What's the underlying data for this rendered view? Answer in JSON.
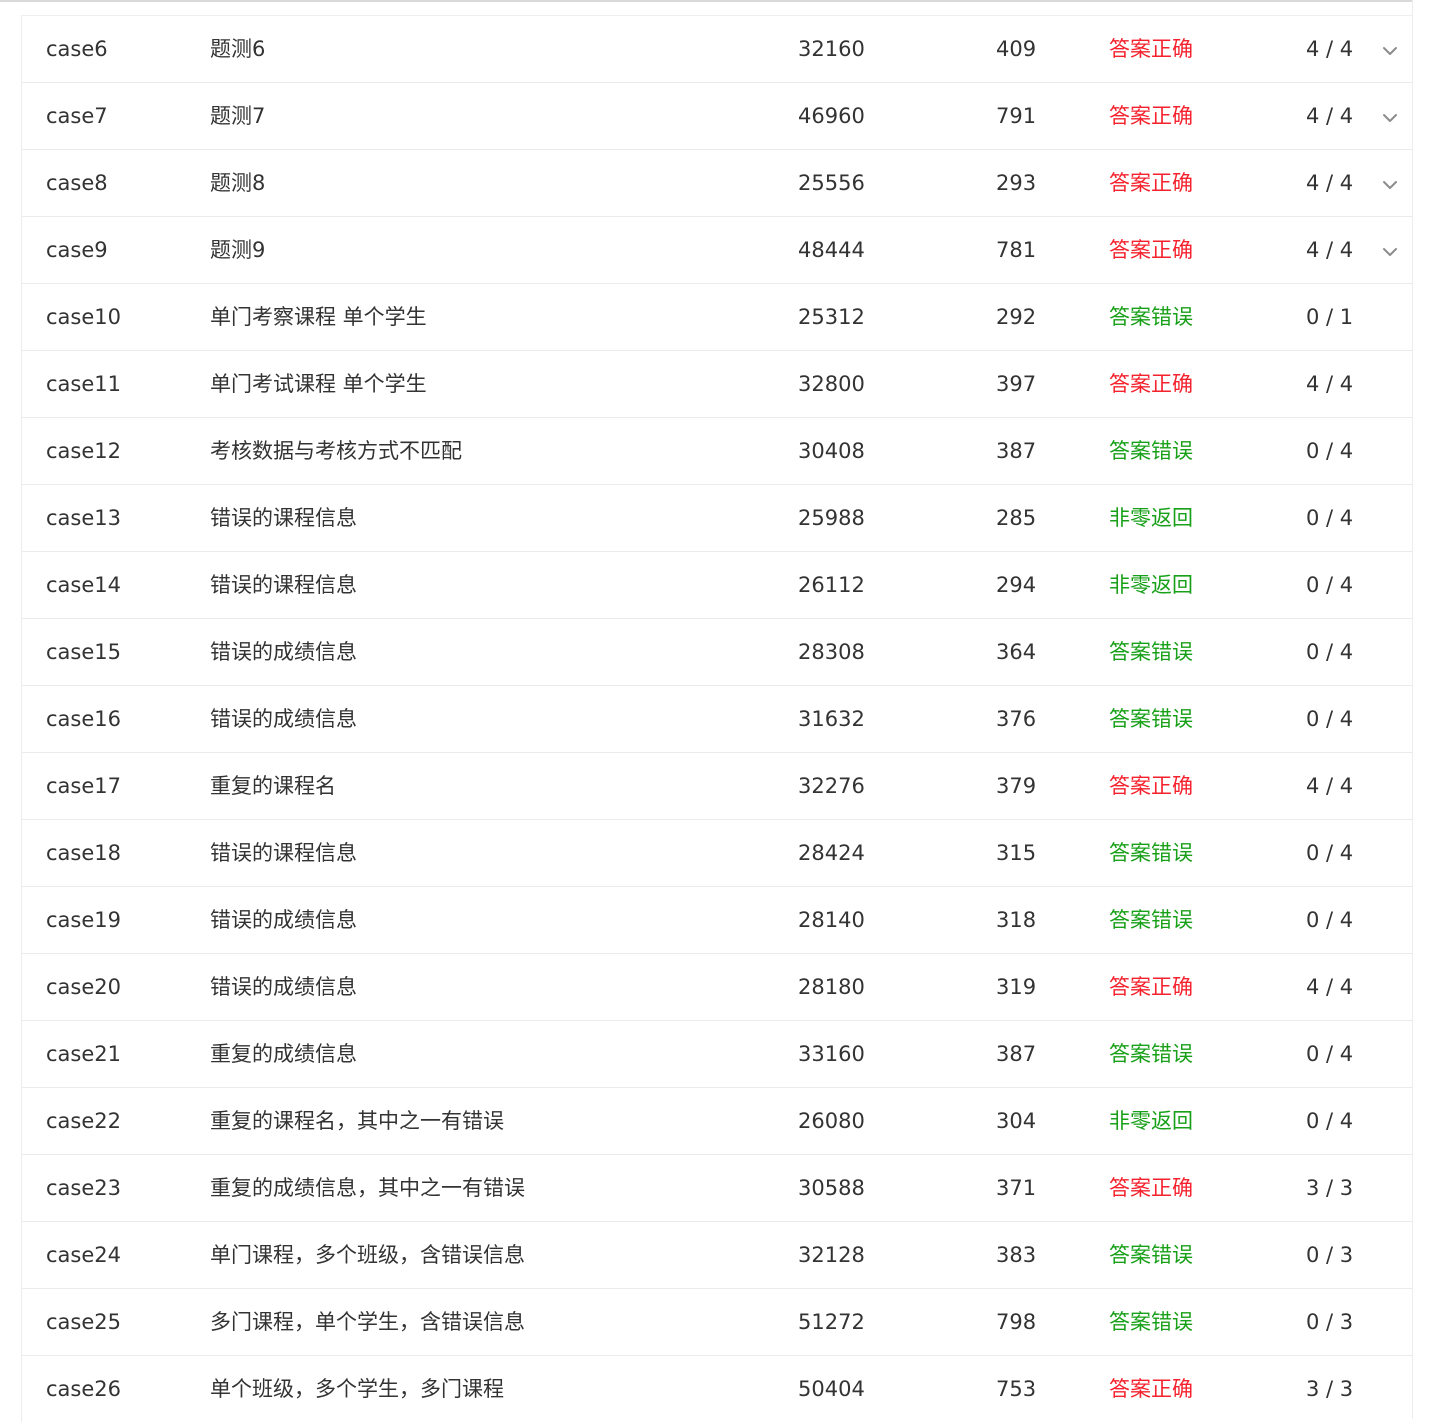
{
  "colors": {
    "correct": "#f5222d",
    "wrong": "#18a018"
  },
  "rows": [
    {
      "name": "case6",
      "desc": "题测6",
      "time": "32160",
      "mem": "409",
      "status": "答案正确",
      "status_type": "correct",
      "score": "4 / 4",
      "expandable": true,
      "expand_icon": "chevron-down-icon"
    },
    {
      "name": "case7",
      "desc": "题测7",
      "time": "46960",
      "mem": "791",
      "status": "答案正确",
      "status_type": "correct",
      "score": "4 / 4",
      "expandable": true,
      "expand_icon": "chevron-down-icon"
    },
    {
      "name": "case8",
      "desc": "题测8",
      "time": "25556",
      "mem": "293",
      "status": "答案正确",
      "status_type": "correct",
      "score": "4 / 4",
      "expandable": true,
      "expand_icon": "chevron-down-icon"
    },
    {
      "name": "case9",
      "desc": "题测9",
      "time": "48444",
      "mem": "781",
      "status": "答案正确",
      "status_type": "correct",
      "score": "4 / 4",
      "expandable": true,
      "expand_icon": "chevron-down-icon"
    },
    {
      "name": "case10",
      "desc": "单门考察课程 单个学生",
      "time": "25312",
      "mem": "292",
      "status": "答案错误",
      "status_type": "wrong",
      "score": "0 / 1",
      "expandable": false
    },
    {
      "name": "case11",
      "desc": "单门考试课程 单个学生",
      "time": "32800",
      "mem": "397",
      "status": "答案正确",
      "status_type": "correct",
      "score": "4 / 4",
      "expandable": false
    },
    {
      "name": "case12",
      "desc": "考核数据与考核方式不匹配",
      "time": "30408",
      "mem": "387",
      "status": "答案错误",
      "status_type": "wrong",
      "score": "0 / 4",
      "expandable": false
    },
    {
      "name": "case13",
      "desc": "错误的课程信息",
      "time": "25988",
      "mem": "285",
      "status": "非零返回",
      "status_type": "wrong",
      "score": "0 / 4",
      "expandable": false
    },
    {
      "name": "case14",
      "desc": "错误的课程信息",
      "time": "26112",
      "mem": "294",
      "status": "非零返回",
      "status_type": "wrong",
      "score": "0 / 4",
      "expandable": false
    },
    {
      "name": "case15",
      "desc": "错误的成绩信息",
      "time": "28308",
      "mem": "364",
      "status": "答案错误",
      "status_type": "wrong",
      "score": "0 / 4",
      "expandable": false
    },
    {
      "name": "case16",
      "desc": "错误的成绩信息",
      "time": "31632",
      "mem": "376",
      "status": "答案错误",
      "status_type": "wrong",
      "score": "0 / 4",
      "expandable": false
    },
    {
      "name": "case17",
      "desc": "重复的课程名",
      "time": "32276",
      "mem": "379",
      "status": "答案正确",
      "status_type": "correct",
      "score": "4 / 4",
      "expandable": false
    },
    {
      "name": "case18",
      "desc": "错误的课程信息",
      "time": "28424",
      "mem": "315",
      "status": "答案错误",
      "status_type": "wrong",
      "score": "0 / 4",
      "expandable": false
    },
    {
      "name": "case19",
      "desc": "错误的成绩信息",
      "time": "28140",
      "mem": "318",
      "status": "答案错误",
      "status_type": "wrong",
      "score": "0 / 4",
      "expandable": false
    },
    {
      "name": "case20",
      "desc": "错误的成绩信息",
      "time": "28180",
      "mem": "319",
      "status": "答案正确",
      "status_type": "correct",
      "score": "4 / 4",
      "expandable": false
    },
    {
      "name": "case21",
      "desc": "重复的成绩信息",
      "time": "33160",
      "mem": "387",
      "status": "答案错误",
      "status_type": "wrong",
      "score": "0 / 4",
      "expandable": false
    },
    {
      "name": "case22",
      "desc": "重复的课程名，其中之一有错误",
      "time": "26080",
      "mem": "304",
      "status": "非零返回",
      "status_type": "wrong",
      "score": "0 / 4",
      "expandable": false
    },
    {
      "name": "case23",
      "desc": "重复的成绩信息，其中之一有错误",
      "time": "30588",
      "mem": "371",
      "status": "答案正确",
      "status_type": "correct",
      "score": "3 / 3",
      "expandable": false
    },
    {
      "name": "case24",
      "desc": "单门课程，多个班级，含错误信息",
      "time": "32128",
      "mem": "383",
      "status": "答案错误",
      "status_type": "wrong",
      "score": "0 / 3",
      "expandable": false
    },
    {
      "name": "case25",
      "desc": "多门课程，单个学生，含错误信息",
      "time": "51272",
      "mem": "798",
      "status": "答案错误",
      "status_type": "wrong",
      "score": "0 / 3",
      "expandable": false
    },
    {
      "name": "case26",
      "desc": "单个班级，多个学生，多门课程",
      "time": "50404",
      "mem": "753",
      "status": "答案正确",
      "status_type": "correct",
      "score": "3 / 3",
      "expandable": false
    }
  ]
}
